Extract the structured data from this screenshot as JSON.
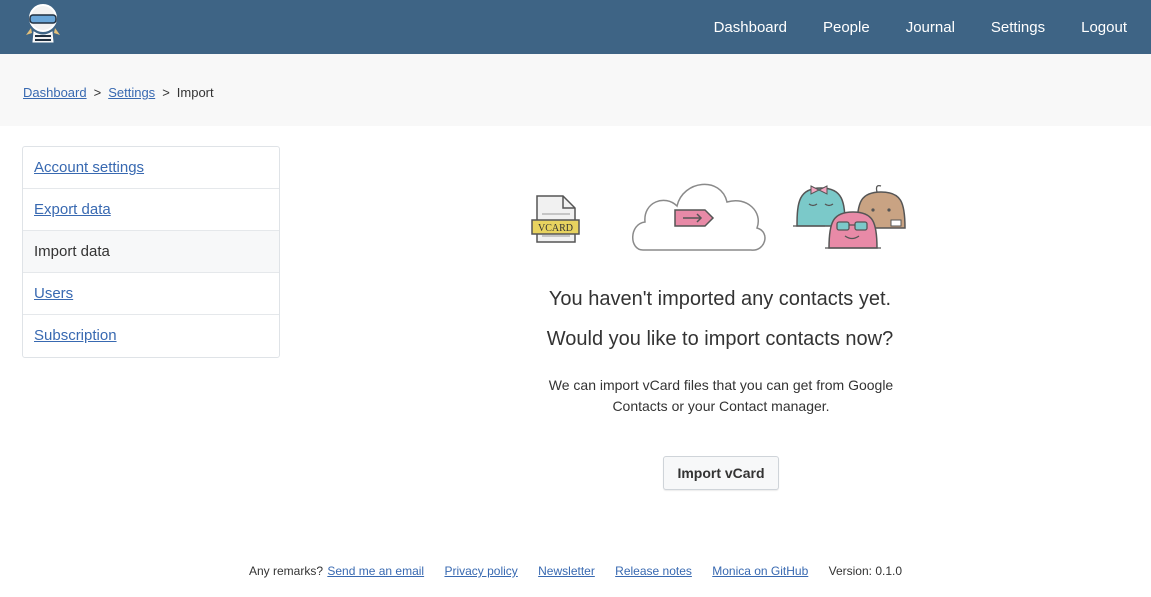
{
  "nav": {
    "dashboard": "Dashboard",
    "people": "People",
    "journal": "Journal",
    "settings": "Settings",
    "logout": "Logout"
  },
  "breadcrumb": {
    "dashboard": "Dashboard",
    "settings": "Settings",
    "current": "Import",
    "separator": ">"
  },
  "sidebar": {
    "items": [
      {
        "label": "Account settings",
        "active": false
      },
      {
        "label": "Export data",
        "active": false
      },
      {
        "label": "Import data",
        "active": true
      },
      {
        "label": "Users",
        "active": false
      },
      {
        "label": "Subscription",
        "active": false
      }
    ]
  },
  "illustration": {
    "vcard_label": "VCARD"
  },
  "main": {
    "title": "You haven't imported any contacts yet.",
    "subtitle": "Would you like to import contacts now?",
    "description": "We can import vCard files that you can get from Google Contacts or your Contact manager.",
    "import_button": "Import vCard"
  },
  "footer": {
    "remarks_prefix": "Any remarks?",
    "email_link": "Send me an email",
    "privacy": "Privacy policy",
    "newsletter": "Newsletter",
    "release_notes": "Release notes",
    "github": "Monica on GitHub",
    "version": "Version: 0.1.0"
  },
  "colors": {
    "topbar": "#3e6485",
    "link": "#3869b1",
    "crumb_bg": "#f8f8f8"
  }
}
